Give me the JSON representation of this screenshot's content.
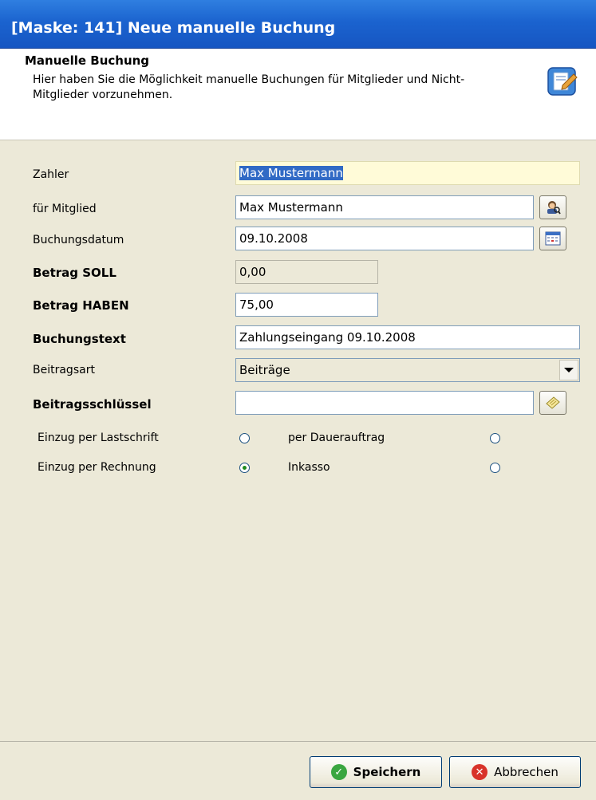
{
  "window": {
    "title": "[Maske: 141] Neue manuelle Buchung"
  },
  "header": {
    "title": "Manuelle Buchung",
    "description": "Hier haben Sie die Möglichkeit manuelle Buchungen für Mitglieder und Nicht-Mitglieder vorzunehmen."
  },
  "form": {
    "zahler": {
      "label": "Zahler",
      "value": "Max Mustermann"
    },
    "mitglied": {
      "label": "für Mitglied",
      "value": "Max Mustermann",
      "button_icon": "member-lookup-icon"
    },
    "datum": {
      "label": "Buchungsdatum",
      "value": "09.10.2008",
      "button_icon": "calendar-icon"
    },
    "soll": {
      "label": "Betrag SOLL",
      "value": "0,00"
    },
    "haben": {
      "label": "Betrag HABEN",
      "value": "75,00"
    },
    "text": {
      "label": "Buchungstext",
      "value": "Zahlungseingang 09.10.2008"
    },
    "beitragsart": {
      "label": "Beitragsart",
      "value": "Beiträge"
    },
    "schluessel": {
      "label": "Beitragsschlüssel",
      "value": "",
      "button_icon": "note-icon"
    }
  },
  "payment": {
    "lastschrift": {
      "label": "Einzug per Lastschrift",
      "checked": false
    },
    "dauerauftrag": {
      "label": "per Dauerauftrag",
      "checked": false
    },
    "rechnung": {
      "label": "Einzug per Rechnung",
      "checked": true
    },
    "inkasso": {
      "label": "Inkasso",
      "checked": false
    }
  },
  "buttons": {
    "save": {
      "label": "Speichern"
    },
    "cancel": {
      "label": "Abbrechen"
    }
  },
  "colors": {
    "titlebar": "#1b63cf",
    "dialog_bg": "#ece9d8",
    "selection": "#316ac5",
    "highlight_field": "#fffbd8"
  }
}
